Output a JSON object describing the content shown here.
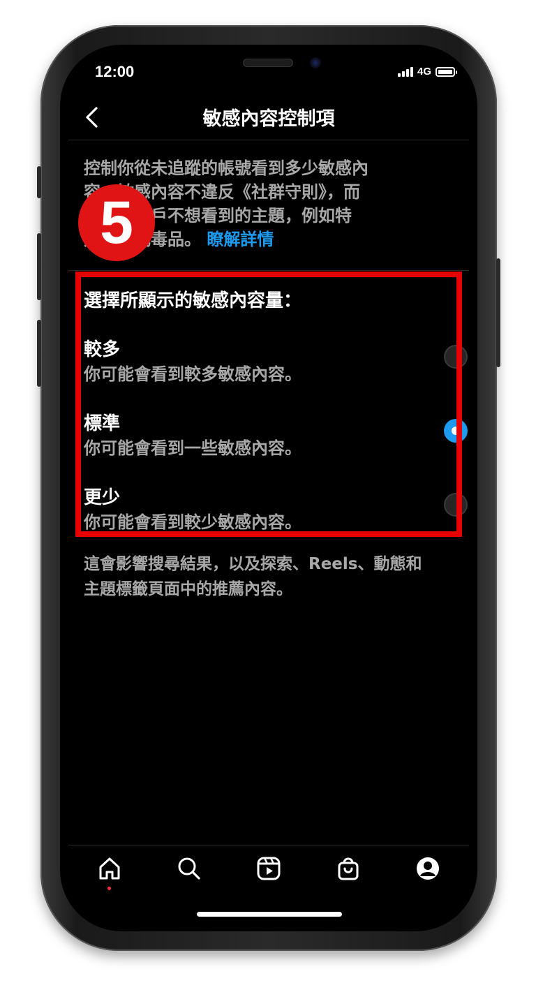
{
  "status_bar": {
    "time": "12:00",
    "network": "4G",
    "icons": [
      "signal-icon",
      "battery-icon"
    ]
  },
  "header": {
    "title": "敏感內容控制項",
    "back_icon": "chevron-left-icon"
  },
  "intro": {
    "lines": [
      "控制你從未追蹤的帳號看到多少敏感內",
      "容。敏感內容不違反《社群守則》，而",
      "是部分用戶不想看到的主題，例如特",
      "定內容或毒品。"
    ],
    "learn_more": "瞭解詳情"
  },
  "step_badge": "5",
  "options": {
    "title": "選擇所顯示的敏感內容量：",
    "items": [
      {
        "label": "較多",
        "description": "你可能會看到較多敏感內容。",
        "selected": false
      },
      {
        "label": "標準",
        "description": "你可能會看到一些敏感內容。",
        "selected": true
      },
      {
        "label": "更少",
        "description": "你可能會看到較少敏感內容。",
        "selected": false
      }
    ]
  },
  "footnote": {
    "lines": [
      "這會影響搜尋結果，以及探索、Reels、動態和",
      "主題標籤頁面中的推薦內容。"
    ]
  },
  "tabbar": {
    "tabs": [
      "home-icon",
      "search-icon",
      "reels-icon",
      "shop-icon",
      "profile-icon"
    ],
    "active": "home-icon"
  },
  "colors": {
    "background": "#000000",
    "accent": "#1d9bf0",
    "highlight": "#e60000",
    "badge": "#e01414"
  }
}
